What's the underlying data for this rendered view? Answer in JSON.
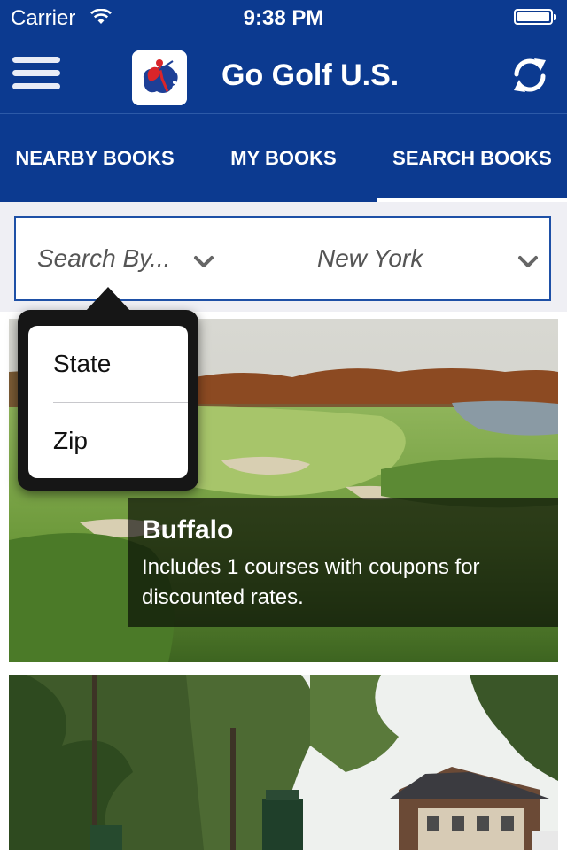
{
  "status_bar": {
    "carrier": "Carrier",
    "time": "9:38 PM",
    "wifi_icon": "wifi-icon",
    "battery_icon": "battery-icon"
  },
  "nav": {
    "title": "Go Golf U.S.",
    "menu_icon": "hamburger-icon",
    "refresh_icon": "refresh-icon",
    "logo": "app-logo"
  },
  "tabs": [
    {
      "label": "NEARBY BOOKS",
      "active": false
    },
    {
      "label": "MY BOOKS",
      "active": false
    },
    {
      "label": "SEARCH BOOKS",
      "active": true
    }
  ],
  "search": {
    "search_by": "Search By...",
    "state_value": "New York",
    "chevron_icon": "chevron-down-icon"
  },
  "popover": {
    "options": [
      "State",
      "Zip"
    ]
  },
  "cards": [
    {
      "title": "Buffalo",
      "description": "Includes 1 courses with coupons for discounted rates."
    },
    {
      "title": "",
      "description": ""
    }
  ],
  "colors": {
    "header": "#0c3a90",
    "accent": "#1e50a6",
    "background": "#efeff4"
  }
}
